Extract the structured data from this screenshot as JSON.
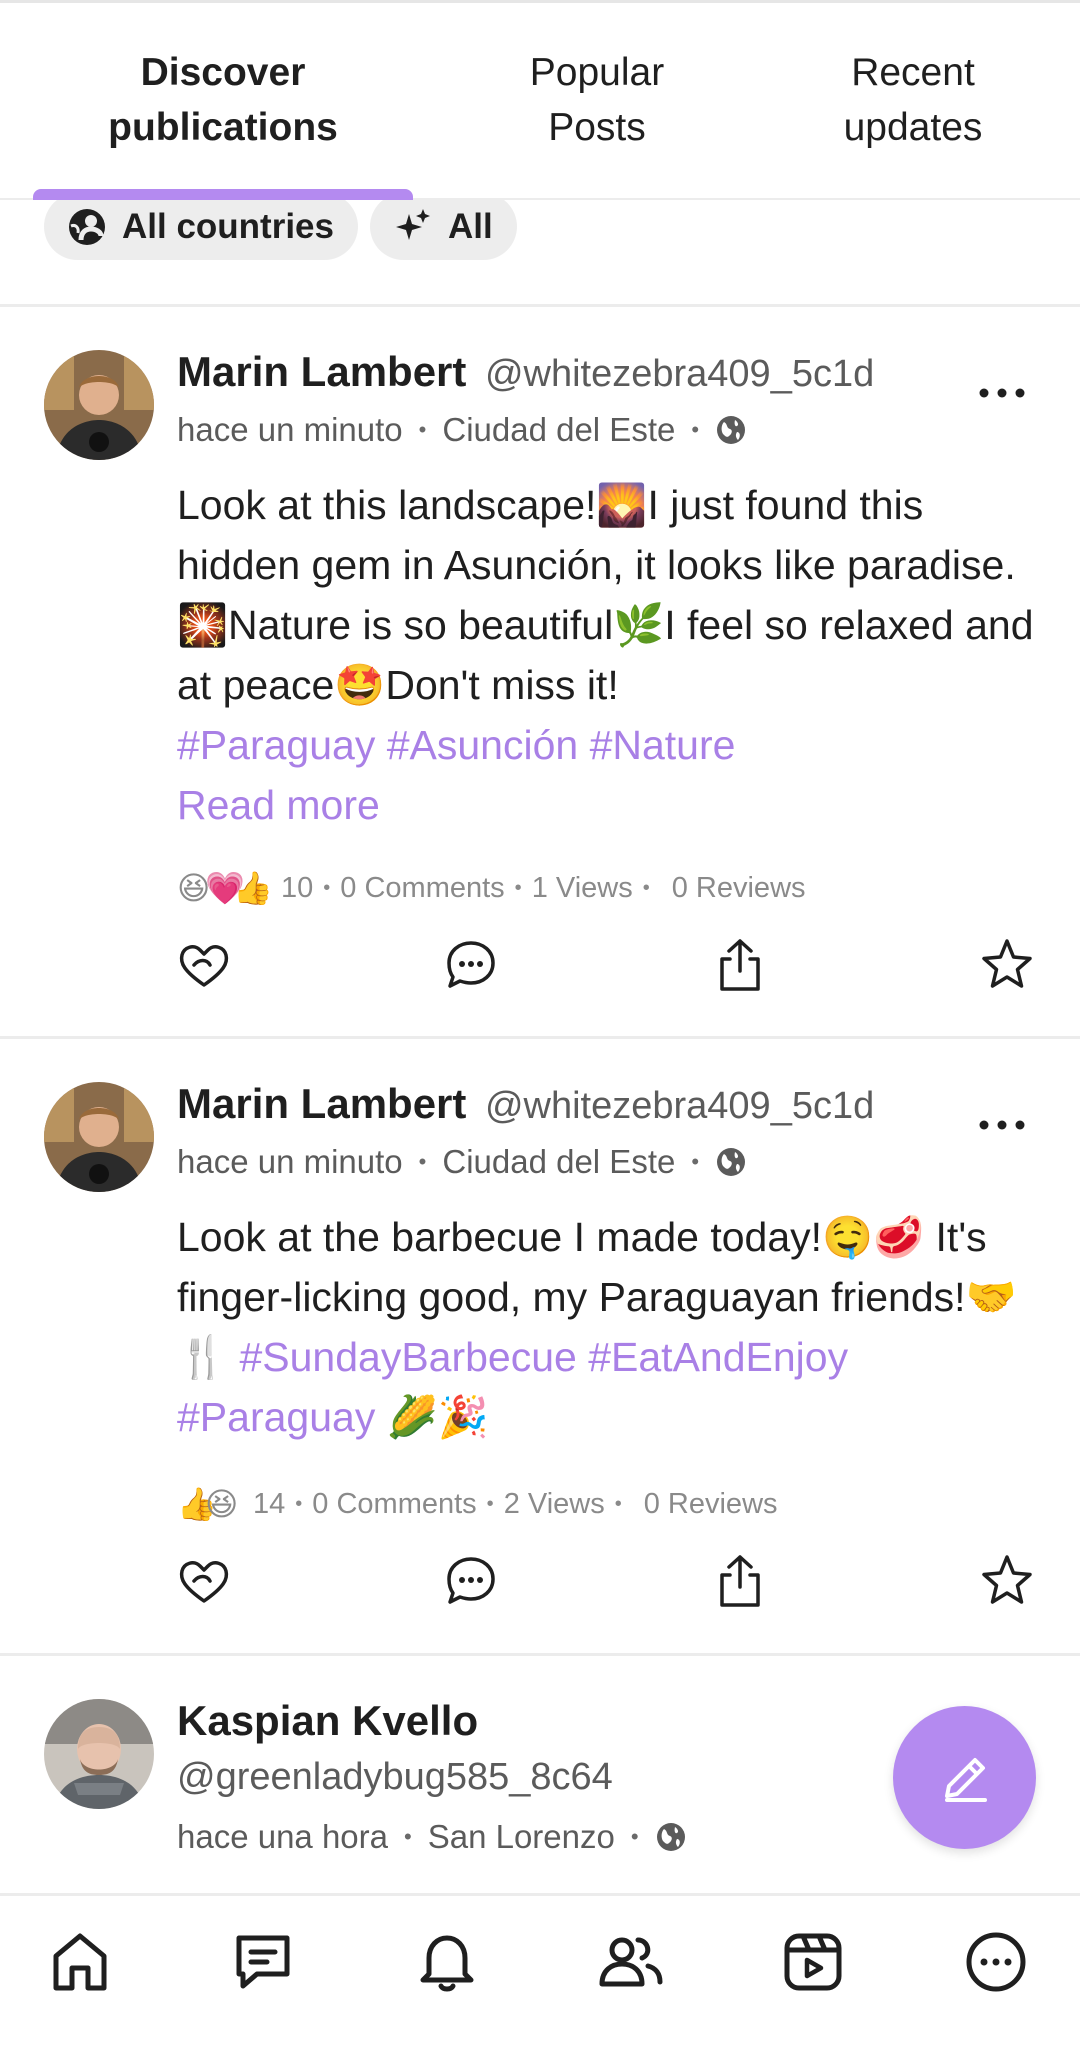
{
  "tabs": [
    {
      "label": "Discover publications",
      "line1": "Discover",
      "line2": "publications",
      "active": true
    },
    {
      "label": "Popular Posts",
      "line1": "Popular",
      "line2": "Posts",
      "active": false
    },
    {
      "label": "Recent updates",
      "line1": "Recent",
      "line2": "updates",
      "active": false
    }
  ],
  "filters": [
    {
      "label": "All countries",
      "icon": "globe-people-icon"
    },
    {
      "label": "All",
      "icon": "sparkles-icon"
    }
  ],
  "posts": [
    {
      "author": "Marin Lambert",
      "handle": "@whitezebra409_5c1d",
      "time": "hace un minuto",
      "location": "Ciudad del Este",
      "visibility_icon": "globe-icon",
      "body_text": "Look at this landscape!🌄I just found this hidden gem in Asunción, it looks like paradise.🎇Nature is so beautiful🌿I feel so relaxed and at peace🤩Don't miss it!",
      "hashtags": "#Paraguay #Asunción #Nature",
      "read_more": "Read more",
      "reaction_emojis": [
        "😆",
        "💗",
        "👍"
      ],
      "reaction_count": "10",
      "comments": "0 Comments",
      "views": "1 Views",
      "reviews": "0 Reviews"
    },
    {
      "author": "Marin Lambert",
      "handle": "@whitezebra409_5c1d",
      "time": "hace un minuto",
      "location": "Ciudad del Este",
      "visibility_icon": "globe-icon",
      "body_text": "Look at the barbecue I made today!🤤🥩 It's finger-licking good, my Paraguayan friends!🤝🍴",
      "hashtags": "#SundayBarbecue #EatAndEnjoy #Paraguay",
      "trailing_emojis": "🌽🎉",
      "reaction_emojis": [
        "👍",
        "😆"
      ],
      "reaction_count": "14",
      "comments": "0 Comments",
      "views": "2 Views",
      "reviews": "0 Reviews"
    },
    {
      "author": "Kaspian Kvello",
      "handle": "@greenladybug585_8c64",
      "time": "hace una hora",
      "location": "San Lorenzo",
      "visibility_icon": "globe-icon"
    }
  ],
  "colors": {
    "accent": "#b48af0",
    "hashtag": "#a980e6",
    "text": "#1f1f1f",
    "muted": "#5b5b5b",
    "chip_bg": "#ededed"
  },
  "fab": {
    "icon": "pencil-icon"
  },
  "bottom_nav": [
    {
      "icon": "home-icon"
    },
    {
      "icon": "chat-icon"
    },
    {
      "icon": "bell-icon"
    },
    {
      "icon": "friends-icon"
    },
    {
      "icon": "reels-icon"
    },
    {
      "icon": "more-circle-icon"
    }
  ]
}
